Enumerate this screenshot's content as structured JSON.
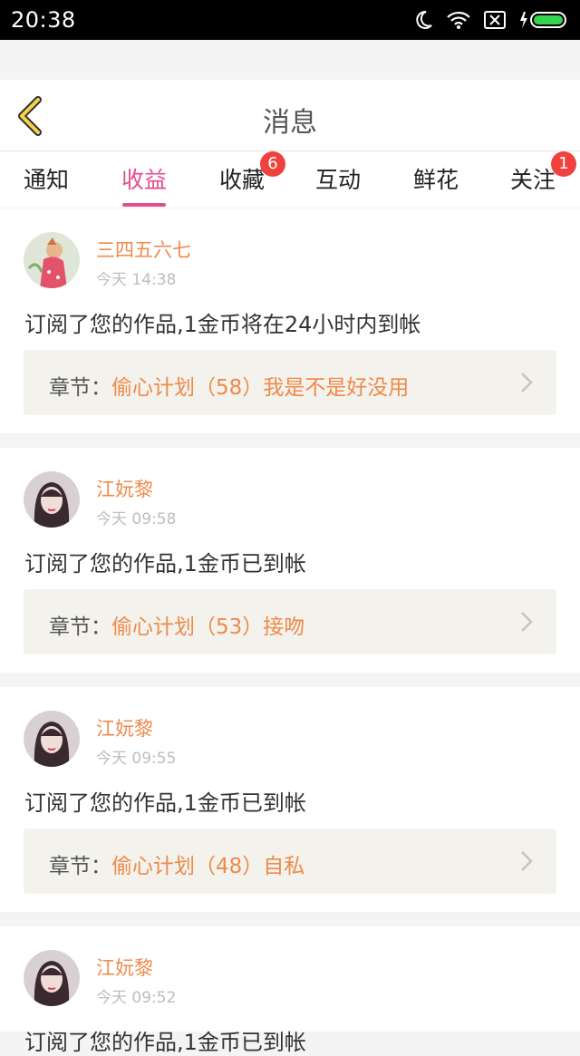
{
  "status_bar": {
    "time": "20:38"
  },
  "header": {
    "title": "消息"
  },
  "tabs": [
    {
      "label": "通知",
      "badge": ""
    },
    {
      "label": "收益",
      "badge": ""
    },
    {
      "label": "收藏",
      "badge": "6"
    },
    {
      "label": "互动",
      "badge": ""
    },
    {
      "label": "鲜花",
      "badge": ""
    },
    {
      "label": "关注",
      "badge": "1"
    }
  ],
  "active_tab": "收益",
  "colors": {
    "accent_pink": "#e64c8f",
    "name_orange": "#ef8a4a",
    "badge_red": "#f0413f"
  },
  "chapter_label": "章节：",
  "messages": [
    {
      "user": "三四五六七",
      "time": "今天 14:38",
      "text": "订阅了您的作品,1金币将在24小时内到帐",
      "chapter": "偷心计划（58）我是不是好没用"
    },
    {
      "user": "江妧黎",
      "time": "今天 09:58",
      "text": "订阅了您的作品,1金币已到帐",
      "chapter": "偷心计划（53）接吻"
    },
    {
      "user": "江妧黎",
      "time": "今天 09:55",
      "text": "订阅了您的作品,1金币已到帐",
      "chapter": "偷心计划（48）自私"
    },
    {
      "user": "江妧黎",
      "time": "今天 09:52",
      "text": "订阅了您的作品,1金币已到帐",
      "chapter": ""
    }
  ]
}
